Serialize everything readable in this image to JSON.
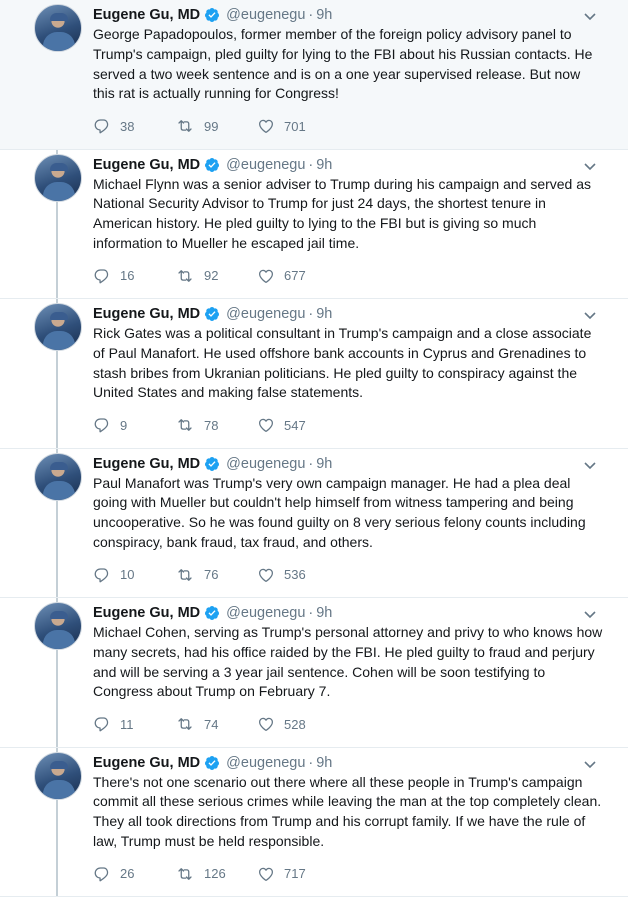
{
  "author": {
    "name": "Eugene Gu, MD",
    "handle": "@eugenegu",
    "separator": "·",
    "verified": true
  },
  "colors": {
    "accent": "#1da1f2",
    "muted": "#657786",
    "thread_line": "#c4cfd6"
  },
  "icons": {
    "reply": "reply-icon",
    "retweet": "retweet-icon",
    "like": "heart-icon",
    "more": "chevron-down-icon",
    "verified": "verified-badge-icon"
  },
  "tweets": [
    {
      "time": "9h",
      "text": "George Papadopoulos, former member of the foreign policy advisory panel to Trump's campaign, pled guilty for lying to the FBI about his Russian contacts. He served a two week sentence and is on a one year supervised release. But now this rat is actually running for Congress!",
      "replies": "38",
      "retweets": "99",
      "likes": "701"
    },
    {
      "time": "9h",
      "text": "Michael Flynn was a senior adviser to Trump during his campaign and served as National Security Advisor to Trump for just 24 days, the shortest tenure in American history. He pled guilty to lying to the FBI but is giving so much information to Mueller he escaped jail time.",
      "replies": "16",
      "retweets": "92",
      "likes": "677"
    },
    {
      "time": "9h",
      "text": "Rick Gates was a political consultant in Trump's campaign and a close associate of Paul Manafort. He used offshore bank accounts in Cyprus and Grenadines to stash bribes from Ukranian politicians. He pled guilty to conspiracy against the United States and making false statements.",
      "replies": "9",
      "retweets": "78",
      "likes": "547"
    },
    {
      "time": "9h",
      "text": "Paul Manafort was Trump's very own campaign manager. He had a plea deal going with Mueller but couldn't help himself from witness tampering and being uncooperative. So he was found guilty on 8 very serious felony counts including conspiracy, bank fraud, tax fraud, and others.",
      "replies": "10",
      "retweets": "76",
      "likes": "536"
    },
    {
      "time": "9h",
      "text": "Michael Cohen, serving as Trump's personal attorney and privy to who knows how many secrets, had his office raided by the FBI. He pled guilty to fraud and perjury and will be serving a 3 year jail sentence. Cohen will be soon testifying to Congress about Trump on February 7.",
      "replies": "11",
      "retweets": "74",
      "likes": "528"
    },
    {
      "time": "9h",
      "text": "There's not one scenario out there where all these people in Trump's campaign commit all these serious crimes while leaving the man at the top completely clean. They all took directions from Trump and his corrupt family. If we have the rule of law, Trump must be held responsible.",
      "replies": "26",
      "retweets": "126",
      "likes": "717"
    }
  ]
}
